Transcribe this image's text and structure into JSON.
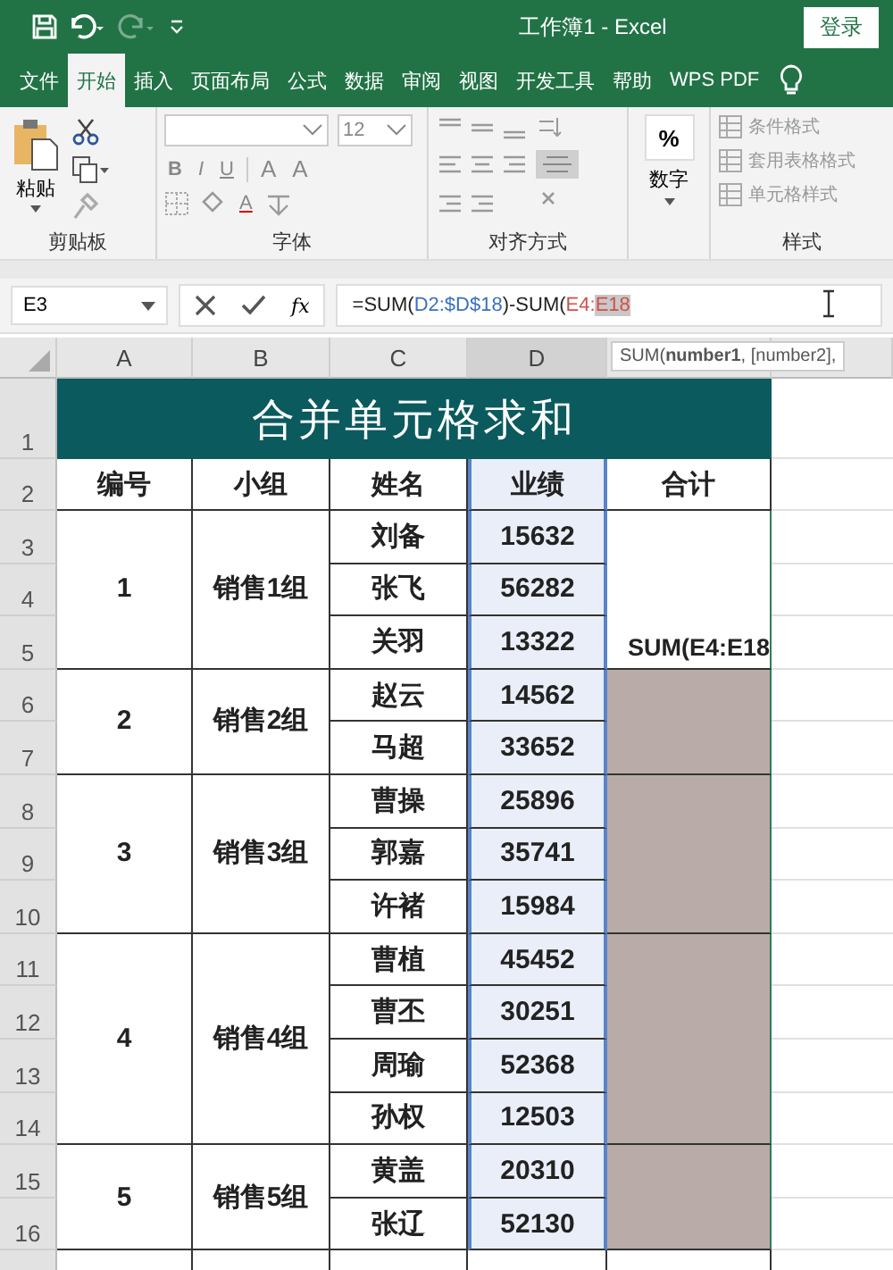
{
  "window": {
    "title": "工作簿1  -  Excel",
    "sign_in": "登录"
  },
  "quick_access": {
    "redo_disabled": true
  },
  "tabs": [
    {
      "label": "文件",
      "selected": false
    },
    {
      "label": "开始",
      "selected": true
    },
    {
      "label": "插入",
      "selected": false
    },
    {
      "label": "页面布局",
      "selected": false
    },
    {
      "label": "公式",
      "selected": false
    },
    {
      "label": "数据",
      "selected": false
    },
    {
      "label": "审阅",
      "selected": false
    },
    {
      "label": "视图",
      "selected": false
    },
    {
      "label": "开发工具",
      "selected": false
    },
    {
      "label": "帮助",
      "selected": false
    },
    {
      "label": "WPS PDF",
      "selected": false
    }
  ],
  "ribbon": {
    "clipboard": {
      "paste": "粘贴",
      "label": "剪贴板"
    },
    "font": {
      "size": "12",
      "format_buttons": [
        "B",
        "I",
        "U"
      ],
      "size_buttons": [
        "A",
        "A"
      ],
      "font_color": "A",
      "label": "字体"
    },
    "alignment": {
      "label": "对齐方式"
    },
    "number": {
      "symbol": "%",
      "label": "数字"
    },
    "styles": {
      "items": [
        "条件格式",
        "套用表格格式",
        "单元格样式"
      ],
      "label": "样式"
    }
  },
  "formula_bar": {
    "name_box": "E3",
    "function_button": "fx",
    "segments": [
      {
        "text": "=SUM(",
        "color": "#222222",
        "highlighted": false
      },
      {
        "text": "D2:$D$18",
        "color": "#3a6fc4",
        "highlighted": false
      },
      {
        "text": ")-SUM(",
        "color": "#222222",
        "highlighted": false
      },
      {
        "text": "E4:",
        "color": "#d0504a",
        "highlighted": false
      },
      {
        "text": "E18",
        "color": "#d0504a",
        "highlighted": true
      }
    ]
  },
  "tooltip": "SUM(**number1**, [number2],",
  "sheet": {
    "columns": [
      {
        "label": "A",
        "selected": false
      },
      {
        "label": "B",
        "selected": false
      },
      {
        "label": "C",
        "selected": false
      },
      {
        "label": "D",
        "selected": true
      }
    ],
    "row_numbers": [
      "1",
      "2",
      "3",
      "4",
      "5",
      "6",
      "7",
      "8",
      "9",
      "10",
      "11",
      "12",
      "13",
      "14",
      "15",
      "16"
    ],
    "title": "合并单元格求和",
    "headers": [
      "编号",
      "小组",
      "姓名",
      "业绩",
      "合计"
    ],
    "groups": [
      {
        "number": "1",
        "team": "销售1组",
        "total": "SUM(E4:E18",
        "highlighted": false,
        "members": [
          {
            "name": "刘备",
            "score": "15632"
          },
          {
            "name": "张飞",
            "score": "56282"
          },
          {
            "name": "关羽",
            "score": "13322"
          }
        ]
      },
      {
        "number": "2",
        "team": "销售2组",
        "highlighted": true,
        "members": [
          {
            "name": "赵云",
            "score": "14562"
          },
          {
            "name": "马超",
            "score": "33652"
          }
        ]
      },
      {
        "number": "3",
        "team": "销售3组",
        "highlighted": true,
        "members": [
          {
            "name": "曹操",
            "score": "25896"
          },
          {
            "name": "郭嘉",
            "score": "35741"
          },
          {
            "name": "许褚",
            "score": "15984"
          }
        ]
      },
      {
        "number": "4",
        "team": "销售4组",
        "highlighted": true,
        "members": [
          {
            "name": "曹植",
            "score": "45452"
          },
          {
            "name": "曹丕",
            "score": "30251"
          },
          {
            "name": "周瑜",
            "score": "52368"
          },
          {
            "name": "孙权",
            "score": "12503"
          }
        ]
      },
      {
        "number": "5",
        "team": "销售5组",
        "highlighted": true,
        "members": [
          {
            "name": "黄盖",
            "score": "20310"
          },
          {
            "name": "张辽",
            "score": "52130"
          }
        ]
      }
    ]
  }
}
